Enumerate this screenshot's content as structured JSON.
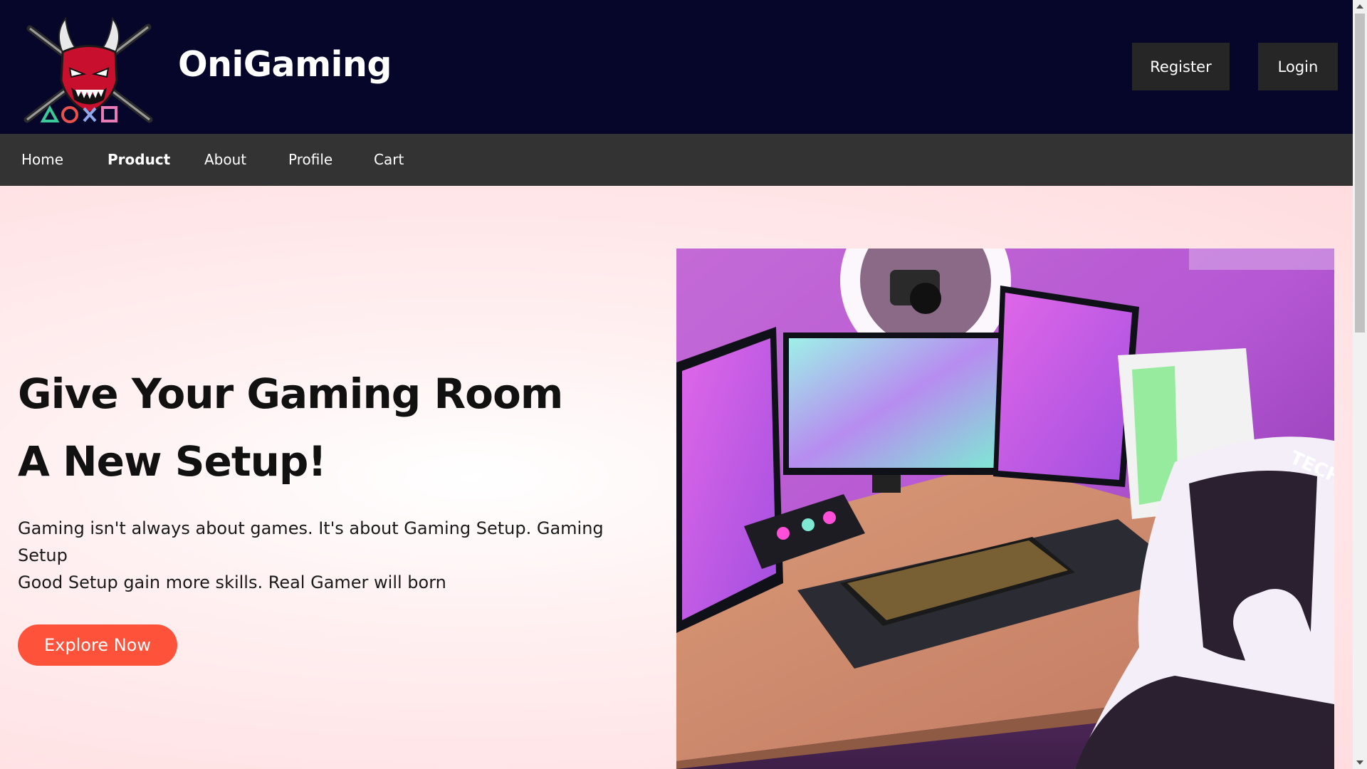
{
  "header": {
    "brand": "OniGaming",
    "register_label": "Register",
    "login_label": "Login",
    "logo_icon": "oni-mask-logo-icon"
  },
  "nav": {
    "items": [
      {
        "label": "Home",
        "active": false
      },
      {
        "label": "Product",
        "active": true
      },
      {
        "label": "About",
        "active": false
      },
      {
        "label": "Profile",
        "active": false
      },
      {
        "label": "Cart",
        "active": false
      }
    ]
  },
  "hero": {
    "title_line1": "Give Your Gaming Room",
    "title_line2": "A New Setup!",
    "text_line1": "Gaming isn't always about games. It's about Gaming Setup. Gaming",
    "text_line2": "Setup",
    "text_line3": "Good Setup gain more skills. Real Gamer will born",
    "cta_label": "Explore Now"
  },
  "image_text": {
    "chair_brand": "TECHNI"
  },
  "colors": {
    "header_bg": "#05062a",
    "nav_bg": "#333333",
    "button_bg": "#262626",
    "accent": "#ff523b",
    "hero_bg": "#ffdcdf"
  }
}
